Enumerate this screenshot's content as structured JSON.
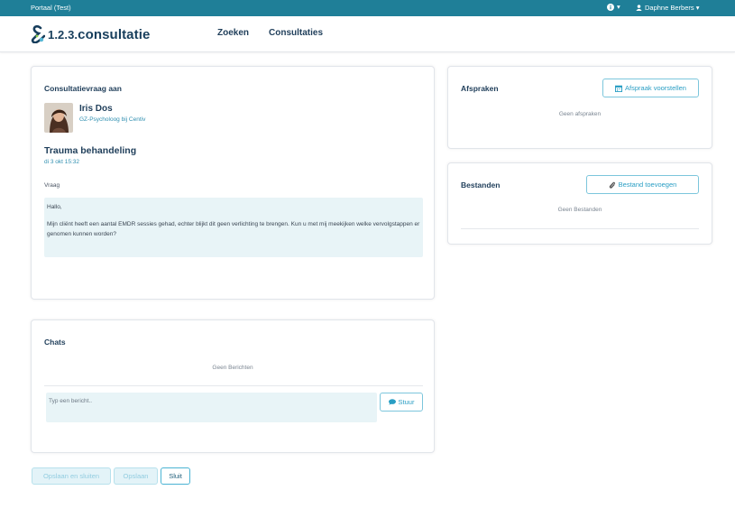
{
  "topbar": {
    "portal_label": "Portaal (Test)",
    "info_caret": "▾",
    "user_name": "Daphne Berbers ▾"
  },
  "logo": {
    "prefix": "1.2.3.",
    "text": "consultatie"
  },
  "nav": {
    "search": "Zoeken",
    "consultations": "Consultaties"
  },
  "consult": {
    "title": "Consultatievraag aan",
    "person_name": "Iris Dos",
    "person_role": "GZ-Psycholoog bij Centiv",
    "subject": "Trauma behandeling",
    "date": "di 3 okt 15:32",
    "question_label": "Vraag",
    "question_greeting": "Hallo,",
    "question_body": "Mijn cliënt heeft een aantal EMDR sessies gehad, echter blijkt dit geen verlichting te brengen. Kun u met mij meekijken welke vervolgstappen er genomen kunnen worden?"
  },
  "chats": {
    "title": "Chats",
    "empty": "Geen Berichten",
    "input_placeholder": "Typ een bericht..",
    "send_label": "Stuur"
  },
  "appointments": {
    "title": "Afspraken",
    "propose_label": "Afspraak voorstellen",
    "empty": "Geen afspraken"
  },
  "files": {
    "title": "Bestanden",
    "add_label": "Bestand toevoegen",
    "empty": "Geen Bestanden"
  },
  "actions": {
    "save_close": "Opslaan en sluiten",
    "save": "Opslaan",
    "close": "Sluit"
  },
  "colors": {
    "topbar": "#1f7f98",
    "accent": "#2a9ec4",
    "dark_text": "#1f3e5a",
    "soft_bg": "#e8f4f7"
  }
}
